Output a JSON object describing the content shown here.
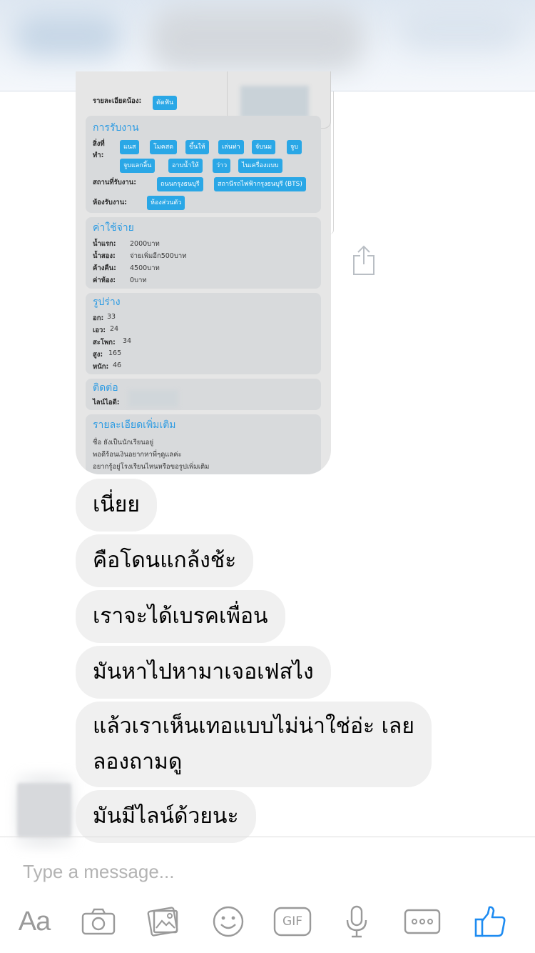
{
  "shared_image": {
    "detail_label": "รายละเอียดน้อง:",
    "detail_chip": "ตัดฟัน",
    "booking": {
      "title": "การรับงาน",
      "services_label": "สิ่งที่ทำ:",
      "services": [
        "แนส",
        "โมคสด",
        "ขึ้นให้",
        "เล่นท่า",
        "จับนม",
        "จูบ",
        "จูบแลกลิ้น",
        "อาบน้ำให้",
        "ว่าว",
        "ไนเครื่องแบบ"
      ],
      "location_label": "สถานที่รับงาน:",
      "locations": [
        "ถนนกรุงธนบุรี",
        "สถานีรถไฟฟ้ากรุงธนบุรี (BTS)"
      ],
      "room_label": "ห้องรับงาน:",
      "room": "ห้องส่วนตัว"
    },
    "costs": {
      "title": "ค่าใช้จ่าย",
      "rows": [
        {
          "label": "น้ำแรก:",
          "value": "2000บาท"
        },
        {
          "label": "น้ำสอง:",
          "value": "จ่ายเพิ่มอีก500บาท"
        },
        {
          "label": "ค้างคืน:",
          "value": "4500บาท"
        },
        {
          "label": "ค่าห้อง:",
          "value": "0บาท"
        }
      ]
    },
    "body": {
      "title": "รูปร่าง",
      "rows": [
        {
          "label": "อก:",
          "value": "33"
        },
        {
          "label": "เอว:",
          "value": "24"
        },
        {
          "label": "สะโพก:",
          "value": "34"
        },
        {
          "label": "สูง:",
          "value": "165"
        },
        {
          "label": "หนัก:",
          "value": "46"
        }
      ]
    },
    "contact": {
      "title": "ติดต่อ",
      "line_label": "ไลน์ไอดี:"
    },
    "more": {
      "title": "รายละเอียดเพิ่มเติม",
      "lines": [
        "ชื่อ      ยังเป็นนักเรียนอยู่",
        "พอดีร้อนเงินอยากหาพี่ๆดูแลค่ะ",
        "อยากรู้อยู่โรงเรียนไหนหรือขอรูปเพิ่มเติม"
      ]
    }
  },
  "messages": [
    "เนี่ยย",
    "คือโดนแกล้งช้ะ",
    "เราจะได้เบรคเพื่อน",
    "มันหาไปหามาเจอเฟสไง",
    "แล้วเราเห็นเทอแบบไม่น่าใช่อ่ะ เลย",
    "ลองถามดู",
    "มันมีไลน์ด้วยนะ"
  ],
  "composer": {
    "placeholder": "Type a message...",
    "aa_label": "Aa",
    "gif_label": "GIF"
  },
  "colors": {
    "accent": "#2aa7e6",
    "like": "#1d8bf1",
    "bubble": "#f0f0f0",
    "icon": "#9a9a9a"
  },
  "icons": [
    "share-icon",
    "camera-icon",
    "gallery-icon",
    "emoji-icon",
    "gif-icon",
    "microphone-icon",
    "more-icon",
    "like-icon"
  ]
}
